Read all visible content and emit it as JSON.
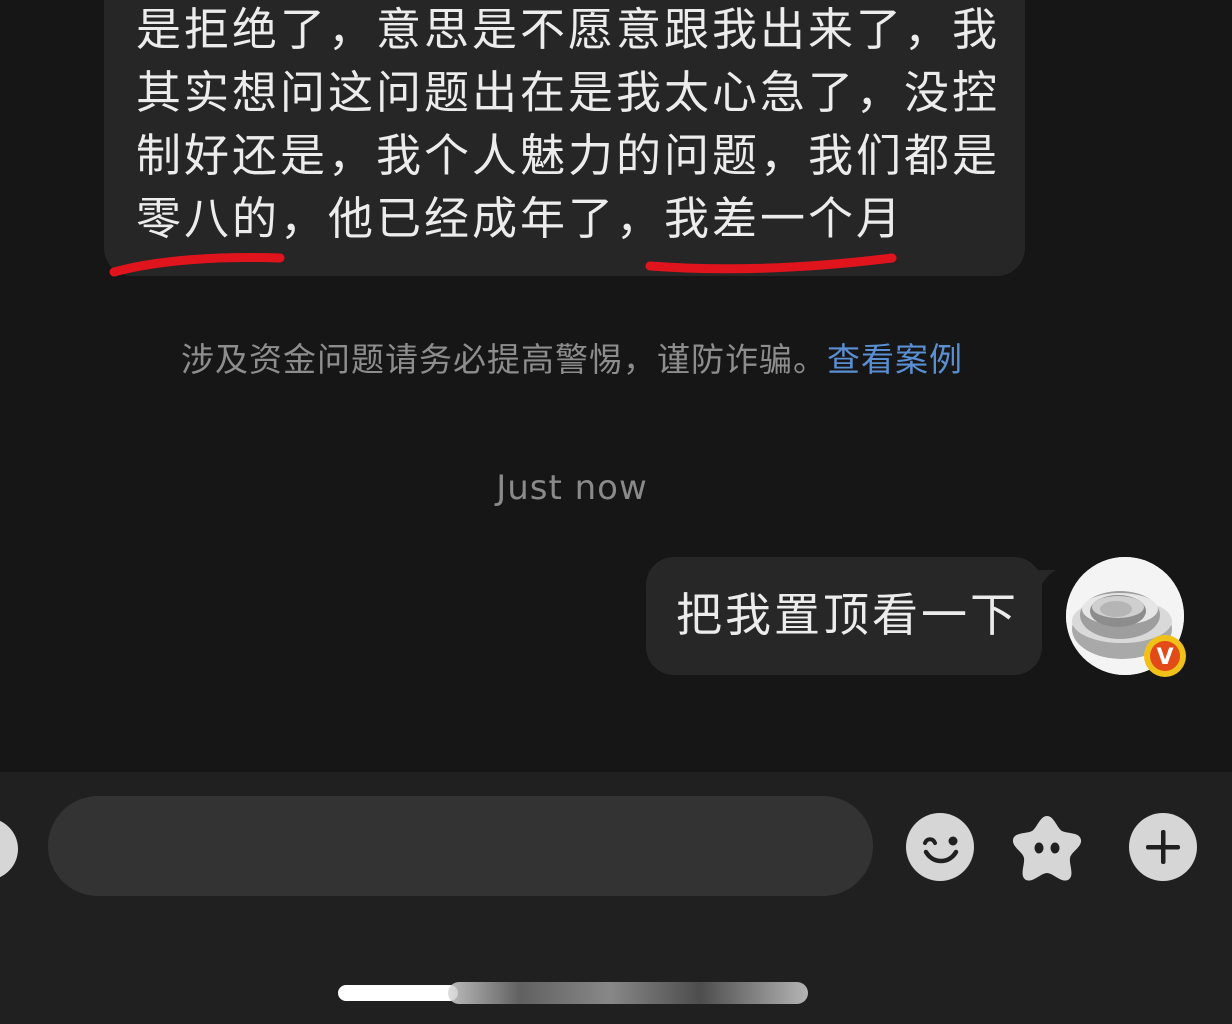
{
  "incoming_message": {
    "lines": [
      "是拒绝了，意思是不愿意跟我出来了，我",
      "其实想问这问题出在是我太心急了，没控",
      "制好还是，我个人魅力的问题，我们都是",
      "零八的，他已经成年了，我差一个月"
    ]
  },
  "warning_notice": {
    "text": "涉及资金问题请务必提高警惕，谨防诈骗。",
    "link": "查看案例"
  },
  "timestamp": "Just now",
  "outgoing_message": {
    "text": "把我置顶看一下"
  },
  "avatar": {
    "badge_letter": "V"
  },
  "input_bar": {
    "message_value": "",
    "icons": [
      "voice-icon",
      "emoji-icon",
      "sticker-icon",
      "plus-icon"
    ]
  },
  "colors": {
    "background": "#161616",
    "bubble": "#262626",
    "input_bar": "#202020",
    "link": "#5b8fd4",
    "underline": "#e0141c",
    "badge": "#f0c219"
  }
}
